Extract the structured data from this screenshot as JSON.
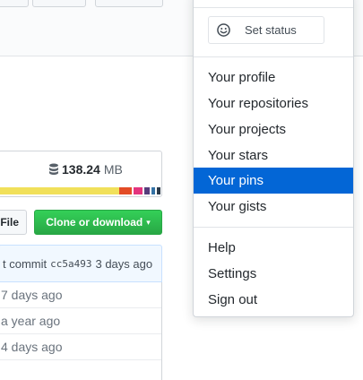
{
  "repo": {
    "size_value": "138.24",
    "size_unit": "MB",
    "language_colors": [
      "#f1e05a",
      "#e34c26",
      "#563d7c",
      "#f34b7d",
      "#3572a5",
      "#2b7489",
      "#555555"
    ],
    "file_button": "File",
    "clone_button": "Clone or download",
    "commit": {
      "prefix": "t commit",
      "sha": "cc5a493",
      "when": "3 days ago"
    },
    "rows": [
      {
        "age": "7 days ago"
      },
      {
        "age": "a year ago"
      },
      {
        "age": "4 days ago"
      }
    ]
  },
  "menu": {
    "set_status": "Set status",
    "section1": [
      "Your profile",
      "Your repositories",
      "Your projects",
      "Your stars",
      "Your pins",
      "Your gists"
    ],
    "active_index": 4,
    "section2": [
      "Help",
      "Settings",
      "Sign out"
    ]
  },
  "colors": {
    "accent": "#0366d6",
    "clone_green": "#28a745"
  }
}
